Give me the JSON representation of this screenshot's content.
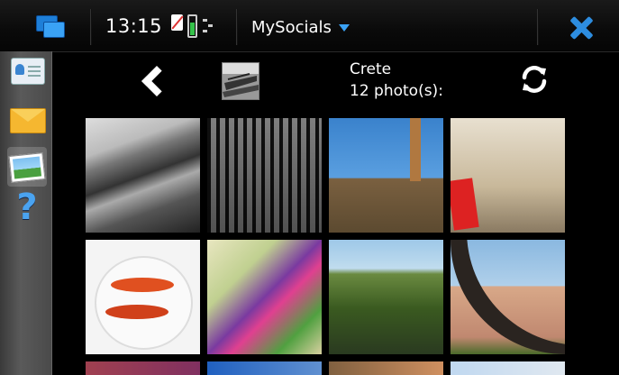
{
  "statusbar": {
    "clock": "13:15",
    "app_title": "MySocials",
    "accent_color": "#2d8de0",
    "icons": [
      "task-switcher-icon",
      "no-sim-icon",
      "battery-icon",
      "signal-icon",
      "dropdown-caret-icon",
      "close-icon"
    ]
  },
  "sidebar": {
    "items": [
      {
        "name": "contacts",
        "icon": "contacts-icon",
        "active": false
      },
      {
        "name": "messages",
        "icon": "mail-icon",
        "active": false
      },
      {
        "name": "photos",
        "icon": "photos-icon",
        "active": true
      },
      {
        "name": "help",
        "icon": "help-icon",
        "label": "?",
        "active": false
      }
    ]
  },
  "album": {
    "name": "Crete",
    "count_label": "12 photo(s):",
    "icons": [
      "back-icon",
      "album-cover",
      "refresh-icon"
    ]
  },
  "photos": [
    {
      "id": 1,
      "subject": "driftwood-bw"
    },
    {
      "id": 2,
      "subject": "gate-bw"
    },
    {
      "id": 3,
      "subject": "chimney-wall"
    },
    {
      "id": 4,
      "subject": "building-poster"
    },
    {
      "id": 5,
      "subject": "fish-plate"
    },
    {
      "id": 6,
      "subject": "graffiti"
    },
    {
      "id": 7,
      "subject": "water-tank-landscape"
    },
    {
      "id": 8,
      "subject": "church-arch"
    },
    {
      "id": 9,
      "subject": "partial"
    },
    {
      "id": 10,
      "subject": "partial"
    },
    {
      "id": 11,
      "subject": "partial"
    },
    {
      "id": 12,
      "subject": "partial"
    }
  ]
}
